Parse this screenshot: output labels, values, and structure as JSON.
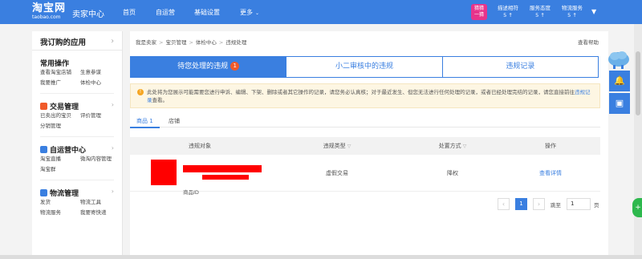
{
  "topbar": {
    "logo_cn": "淘宝网",
    "logo_en": "taobao.com",
    "seller_center": "卖家中心",
    "nav": [
      "首页",
      "自运营",
      "基础设置",
      "更多"
    ],
    "badge": [
      "猜猜",
      "一猜"
    ],
    "stats": [
      {
        "label": "描述相符",
        "value": "5 ↑"
      },
      {
        "label": "服务态度",
        "value": "5 ↑"
      },
      {
        "label": "物流服务",
        "value": "5 ↑"
      }
    ]
  },
  "sidebar": {
    "title": "我订购的应用",
    "common_title": "常用操作",
    "common_items": [
      "查看淘宝店铺",
      "生意参谋",
      "我要推广",
      "体检中心"
    ],
    "sections": [
      {
        "title": "交易管理",
        "items": [
          "已卖出的宝贝",
          "评价管理",
          "分销管理"
        ]
      },
      {
        "title": "自运营中心",
        "items": [
          "淘宝直播",
          "微淘内容管理",
          "淘宝群"
        ]
      },
      {
        "title": "物流管理",
        "items": [
          "发货",
          "物流工具",
          "物流服务",
          "我要寄快递"
        ]
      }
    ]
  },
  "main": {
    "breadcrumbs": [
      "我是卖家",
      "宝贝管理",
      "体检中心",
      "违规处理"
    ],
    "help": "查看帮助",
    "tabs": [
      {
        "label": "待您处理的违规",
        "count": "1"
      },
      {
        "label": "小二审核中的违规"
      },
      {
        "label": "违规记录"
      }
    ],
    "notice": {
      "text": "此处将为您展示可能需要您进行申诉、编辑、下架、删除或者其它操作的记录，请您务必认真核；对于最近发生、但您无法进行任何处理的记录，或者已经处理完结的记录，请您直接前往",
      "link": "违规记录",
      "suffix": "查看。"
    },
    "subtabs": [
      "商品 1",
      "店铺"
    ],
    "table": {
      "headers": [
        "违规对象",
        "违规类型",
        "处置方式",
        "操作"
      ],
      "rows": [
        {
          "pid_label": "商品ID",
          "type": "虚假交易",
          "action": "降权",
          "op": "查看详情"
        }
      ]
    },
    "pager": {
      "prev": "‹",
      "current": "1",
      "next": "›",
      "goto": "跳至",
      "input": "1",
      "unit": "页"
    }
  },
  "colors": {
    "primary": "#3a7fe0",
    "warning": "#f5a623",
    "badge": "#f05a2a"
  }
}
